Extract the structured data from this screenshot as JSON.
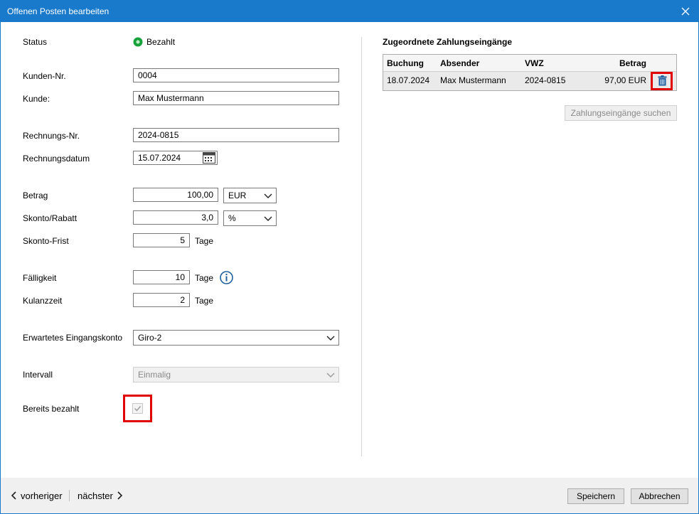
{
  "window": {
    "title": "Offenen Posten bearbeiten",
    "accent_color": "#1979ca"
  },
  "form": {
    "status_label": "Status",
    "status_value": "Bezahlt",
    "status_color": "#17a13a",
    "kunden_nr_label": "Kunden-Nr.",
    "kunden_nr_value": "0004",
    "kunde_label": "Kunde:",
    "kunde_value": "Max Mustermann",
    "rechnungs_nr_label": "Rechnungs-Nr.",
    "rechnungs_nr_value": "2024-0815",
    "rechnungsdatum_label": "Rechnungsdatum",
    "rechnungsdatum_value": "15.07.2024",
    "betrag_label": "Betrag",
    "betrag_value": "100,00",
    "currency_value": "EUR",
    "skonto_label": "Skonto/Rabatt",
    "skonto_value": "3,0",
    "skonto_unit": "%",
    "skonto_frist_label": "Skonto-Frist",
    "skonto_frist_value": "5",
    "faelligkeit_label": "Fälligkeit",
    "faelligkeit_value": "10",
    "kulanzzeit_label": "Kulanzzeit",
    "kulanzzeit_value": "2",
    "tage_label": "Tage",
    "eingangskonto_label": "Erwartetes Eingangskonto",
    "eingangskonto_value": "Giro-2",
    "intervall_label": "Intervall",
    "intervall_value": "Einmalig",
    "bereits_bezahlt_label": "Bereits bezahlt",
    "bereits_bezahlt_checked": true
  },
  "payments": {
    "title": "Zugeordnete Zahlungseingänge",
    "columns": [
      "Buchung",
      "Absender",
      "VWZ",
      "Betrag"
    ],
    "rows": [
      {
        "buchung": "18.07.2024",
        "absender": "Max Mustermann",
        "vwz": "2024-0815",
        "betrag": "97,00 EUR"
      }
    ],
    "search_button": "Zahlungseingänge suchen"
  },
  "footer": {
    "prev_label": "vorheriger",
    "next_label": "nächster",
    "save_label": "Speichern",
    "cancel_label": "Abbrechen"
  },
  "highlight_color": "#e00000"
}
